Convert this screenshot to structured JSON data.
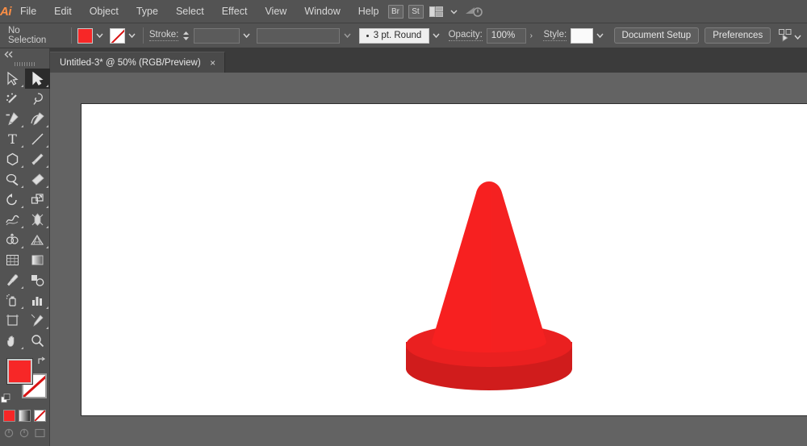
{
  "app": {
    "name": "Adobe Illustrator",
    "logo_text": "Ai"
  },
  "menubar": {
    "items": [
      {
        "label": "File"
      },
      {
        "label": "Edit"
      },
      {
        "label": "Object"
      },
      {
        "label": "Type"
      },
      {
        "label": "Select"
      },
      {
        "label": "Effect"
      },
      {
        "label": "View"
      },
      {
        "label": "Window"
      },
      {
        "label": "Help"
      }
    ],
    "right": {
      "bridge_label": "Br",
      "stock_label": "St",
      "arrange_icon": "arrange-documents-icon",
      "arrange_chevron": "chevron-down-icon",
      "sync_icon": "cloud-sync-icon"
    }
  },
  "controlbar": {
    "selection_status": "No Selection",
    "fill": {
      "label": "fill-swatch",
      "color": "#f72727"
    },
    "stroke_swatch": {
      "label": "stroke-swatch",
      "color": "none"
    },
    "stroke_label": "Stroke:",
    "stroke_weight_value": "",
    "variable_width_value": "",
    "brush_definition": "3 pt. Round",
    "opacity_label": "Opacity:",
    "opacity_value": "100%",
    "style_label": "Style:",
    "style_swatch_color": "#fafafa",
    "document_setup_label": "Document Setup",
    "preferences_label": "Preferences",
    "align_icon": "select-similar-objects-icon"
  },
  "tabbar": {
    "document_title": "Untitled-3* @ 50% (RGB/Preview)",
    "close_label": "×"
  },
  "toolbar": {
    "collapse_icon": "double-chevron-left-icon",
    "tools": [
      {
        "name": "direct-selection-tool",
        "active": false,
        "has_flyout": true
      },
      {
        "name": "selection-tool",
        "active": true,
        "has_flyout": true
      },
      {
        "name": "magic-wand-tool",
        "active": false,
        "has_flyout": false
      },
      {
        "name": "lasso-tool",
        "active": false,
        "has_flyout": false
      },
      {
        "name": "pen-tool",
        "active": false,
        "has_flyout": true
      },
      {
        "name": "curvature-tool",
        "active": false,
        "has_flyout": true
      },
      {
        "name": "type-tool",
        "active": false,
        "has_flyout": true
      },
      {
        "name": "line-segment-tool",
        "active": false,
        "has_flyout": true
      },
      {
        "name": "polygon-shape-tool",
        "active": false,
        "has_flyout": true
      },
      {
        "name": "paintbrush-tool",
        "active": false,
        "has_flyout": true
      },
      {
        "name": "shaper-pencil-tool",
        "active": false,
        "has_flyout": true
      },
      {
        "name": "eraser-tool",
        "active": false,
        "has_flyout": true
      },
      {
        "name": "rotate-tool",
        "active": false,
        "has_flyout": true
      },
      {
        "name": "scale-tool",
        "active": false,
        "has_flyout": true
      },
      {
        "name": "width-warp-tool",
        "active": false,
        "has_flyout": true
      },
      {
        "name": "free-transform-tool",
        "active": false,
        "has_flyout": false
      },
      {
        "name": "shape-builder-tool",
        "active": false,
        "has_flyout": true
      },
      {
        "name": "perspective-grid-tool",
        "active": false,
        "has_flyout": true
      },
      {
        "name": "mesh-tool",
        "active": false,
        "has_flyout": false
      },
      {
        "name": "gradient-tool",
        "active": false,
        "has_flyout": false
      },
      {
        "name": "eyedropper-tool",
        "active": false,
        "has_flyout": true
      },
      {
        "name": "blend-tool",
        "active": false,
        "has_flyout": false
      },
      {
        "name": "symbol-sprayer-tool",
        "active": false,
        "has_flyout": true
      },
      {
        "name": "column-graph-tool",
        "active": false,
        "has_flyout": true
      },
      {
        "name": "artboard-tool",
        "active": false,
        "has_flyout": false
      },
      {
        "name": "slice-tool",
        "active": false,
        "has_flyout": true
      },
      {
        "name": "hand-tool",
        "active": false,
        "has_flyout": true
      },
      {
        "name": "zoom-tool",
        "active": false,
        "has_flyout": false
      }
    ],
    "fill_stroke": {
      "fill_color": "#f72727",
      "stroke_color": "none",
      "swap_icon": "swap-fill-stroke-icon",
      "default_icon": "default-fill-stroke-icon"
    },
    "modes": [
      {
        "name": "color-mode-button",
        "type": "color"
      },
      {
        "name": "gradient-mode-button",
        "type": "gradient"
      },
      {
        "name": "none-mode-button",
        "type": "none"
      }
    ],
    "bottom_modes": [
      {
        "name": "normal-screen-mode-button"
      },
      {
        "name": "drawing-mode-button"
      },
      {
        "name": "screen-mode-button"
      }
    ]
  },
  "canvas": {
    "background_color": "#636363",
    "artboard_color": "#ffffff",
    "artwork": {
      "name": "traffic-cone",
      "body_color": "#f72020",
      "body_shade_color": "#ee1c1c",
      "base_top_color": "#ee2222",
      "base_side_color": "#d91e1e"
    }
  }
}
